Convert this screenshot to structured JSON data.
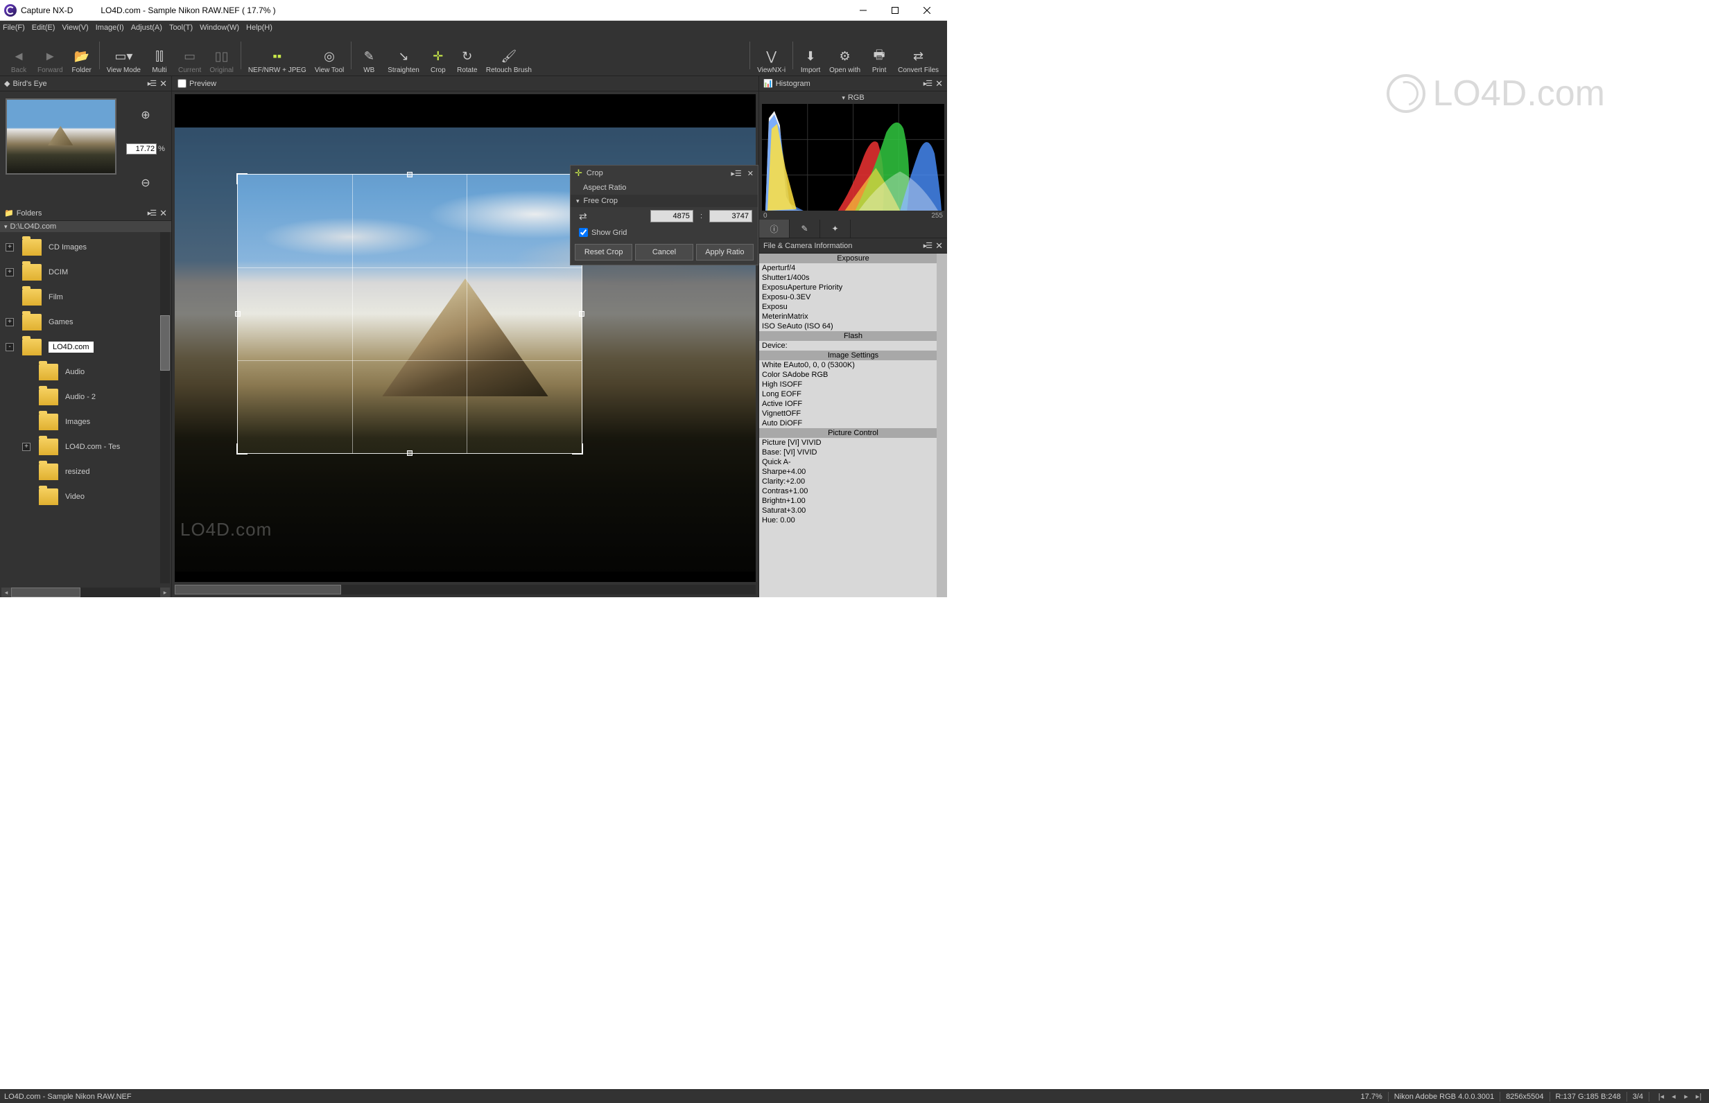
{
  "title": {
    "app": "Capture NX-D",
    "doc": "LO4D.com - Sample Nikon RAW.NEF ( 17.7% )"
  },
  "menu": [
    "File(F)",
    "Edit(E)",
    "View(V)",
    "Image(I)",
    "Adjust(A)",
    "Tool(T)",
    "Window(W)",
    "Help(H)"
  ],
  "toolbar": {
    "back": "Back",
    "forward": "Forward",
    "folder": "Folder",
    "viewmode": "View Mode",
    "multi": "Multi",
    "current": "Current",
    "original": "Original",
    "nef": "NEF/NRW + JPEG",
    "viewtool": "View Tool",
    "wb": "WB",
    "straighten": "Straighten",
    "crop": "Crop",
    "rotate": "Rotate",
    "retouch": "Retouch Brush",
    "viewnx": "ViewNX-i",
    "import": "Import",
    "openwith": "Open with",
    "print": "Print",
    "convert": "Convert Files"
  },
  "panels": {
    "birdseye": "Bird's Eye",
    "folders": "Folders",
    "preview": "Preview",
    "histogram": "Histogram",
    "fcinfo": "File & Camera Information"
  },
  "zoom": {
    "value": "17.72",
    "pct": "%"
  },
  "folderpath": "D:\\LO4D.com",
  "tree": [
    {
      "exp": "+",
      "depth": 0,
      "label": "CD Images"
    },
    {
      "exp": "+",
      "depth": 0,
      "label": "DCIM"
    },
    {
      "exp": "",
      "depth": 0,
      "label": "Film"
    },
    {
      "exp": "+",
      "depth": 0,
      "label": "Games"
    },
    {
      "exp": "-",
      "depth": 0,
      "label": "LO4D.com",
      "sel": true
    },
    {
      "exp": "",
      "depth": 1,
      "label": "Audio"
    },
    {
      "exp": "",
      "depth": 1,
      "label": "Audio - 2"
    },
    {
      "exp": "",
      "depth": 1,
      "label": "Images"
    },
    {
      "exp": "+",
      "depth": 1,
      "label": "LO4D.com - Tes"
    },
    {
      "exp": "",
      "depth": 1,
      "label": "resized"
    },
    {
      "exp": "",
      "depth": 1,
      "label": "Video"
    }
  ],
  "crop": {
    "title": "Crop",
    "aspect": "Aspect Ratio",
    "freecrop": "Free Crop",
    "w": "4875",
    "h": "3747",
    "showgrid": "Show Grid",
    "reset": "Reset Crop",
    "cancel": "Cancel",
    "apply": "Apply Ratio"
  },
  "rgb": "RGB",
  "histaxis": {
    "min": "0",
    "max": "255"
  },
  "fcinfo": {
    "sections": {
      "exposure": "Exposure",
      "flash": "Flash",
      "imgset": "Image Settings",
      "picctrl": "Picture Control"
    },
    "rows": {
      "aperture": "Aperturf/4",
      "shutter": "Shutter1/400s",
      "expprog": "ExposuAperture Priority",
      "expcomp": "Exposu-0.3EV",
      "exptune": "Exposu",
      "metering": "MeterinMatrix",
      "iso": "ISO SeAuto (ISO 64)",
      "device": "Device:",
      "wb": "White EAuto0, 0, 0 (5300K)",
      "colorspace": "Color SAdobe RGB",
      "highiso": "High ISOFF",
      "longexp": "Long EOFF",
      "actived": "Active IOFF",
      "vign": "VignettOFF",
      "autodist": "Auto DiOFF",
      "picture": "Picture [VI] VIVID",
      "base": "Base:   [VI] VIVID",
      "quick": "Quick A-",
      "sharpen": "Sharpe+4.00",
      "clarity": "Clarity:+2.00",
      "contrast": "Contras+1.00",
      "bright": "Brightn+1.00",
      "saturate": "Saturat+3.00",
      "hue": "Hue:    0.00"
    }
  },
  "status": {
    "file": "LO4D.com - Sample Nikon RAW.NEF",
    "zoom": "17.7%",
    "profile": "Nikon Adobe RGB 4.0.0.3001",
    "dims": "8256x5504",
    "rgb": "R:137 G:185 B:248",
    "page": "3/4"
  },
  "watermark": "LO4D.com"
}
